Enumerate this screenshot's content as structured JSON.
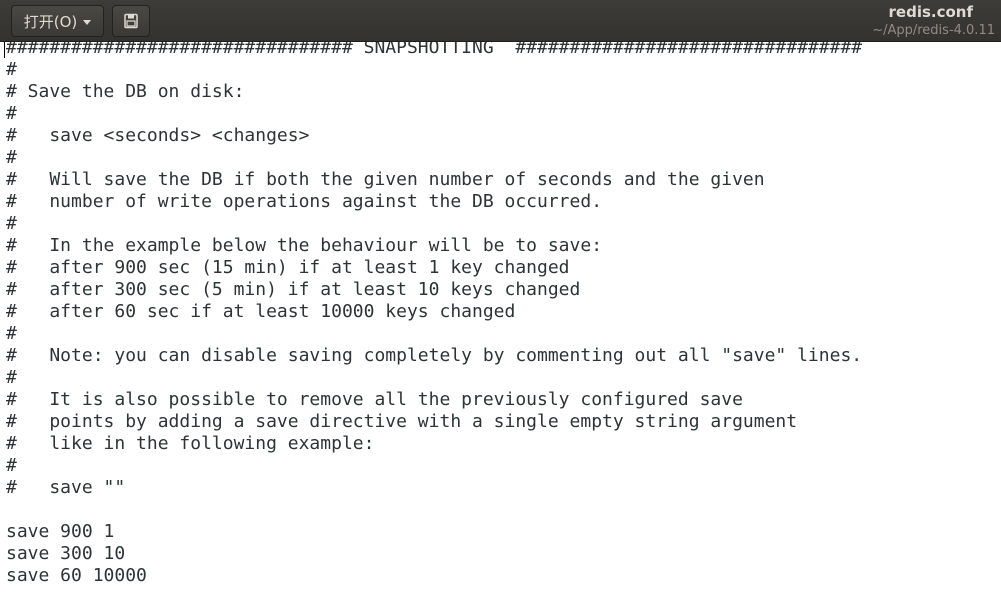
{
  "toolbar": {
    "open_label": "打开(O)",
    "save_icon": "save-document-icon"
  },
  "window": {
    "title": "redis.conf",
    "subtitle": "~/App/redis-4.0.11"
  },
  "editor": {
    "lines": [
      "################################ SNAPSHOTTING  ################################",
      "#",
      "# Save the DB on disk:",
      "#",
      "#   save <seconds> <changes>",
      "#",
      "#   Will save the DB if both the given number of seconds and the given",
      "#   number of write operations against the DB occurred.",
      "#",
      "#   In the example below the behaviour will be to save:",
      "#   after 900 sec (15 min) if at least 1 key changed",
      "#   after 300 sec (5 min) if at least 10 keys changed",
      "#   after 60 sec if at least 10000 keys changed",
      "#",
      "#   Note: you can disable saving completely by commenting out all \"save\" lines.",
      "#",
      "#   It is also possible to remove all the previously configured save",
      "#   points by adding a save directive with a single empty string argument",
      "#   like in the following example:",
      "#",
      "#   save \"\"",
      "",
      "save 900 1",
      "save 300 10",
      "save 60 10000"
    ]
  }
}
